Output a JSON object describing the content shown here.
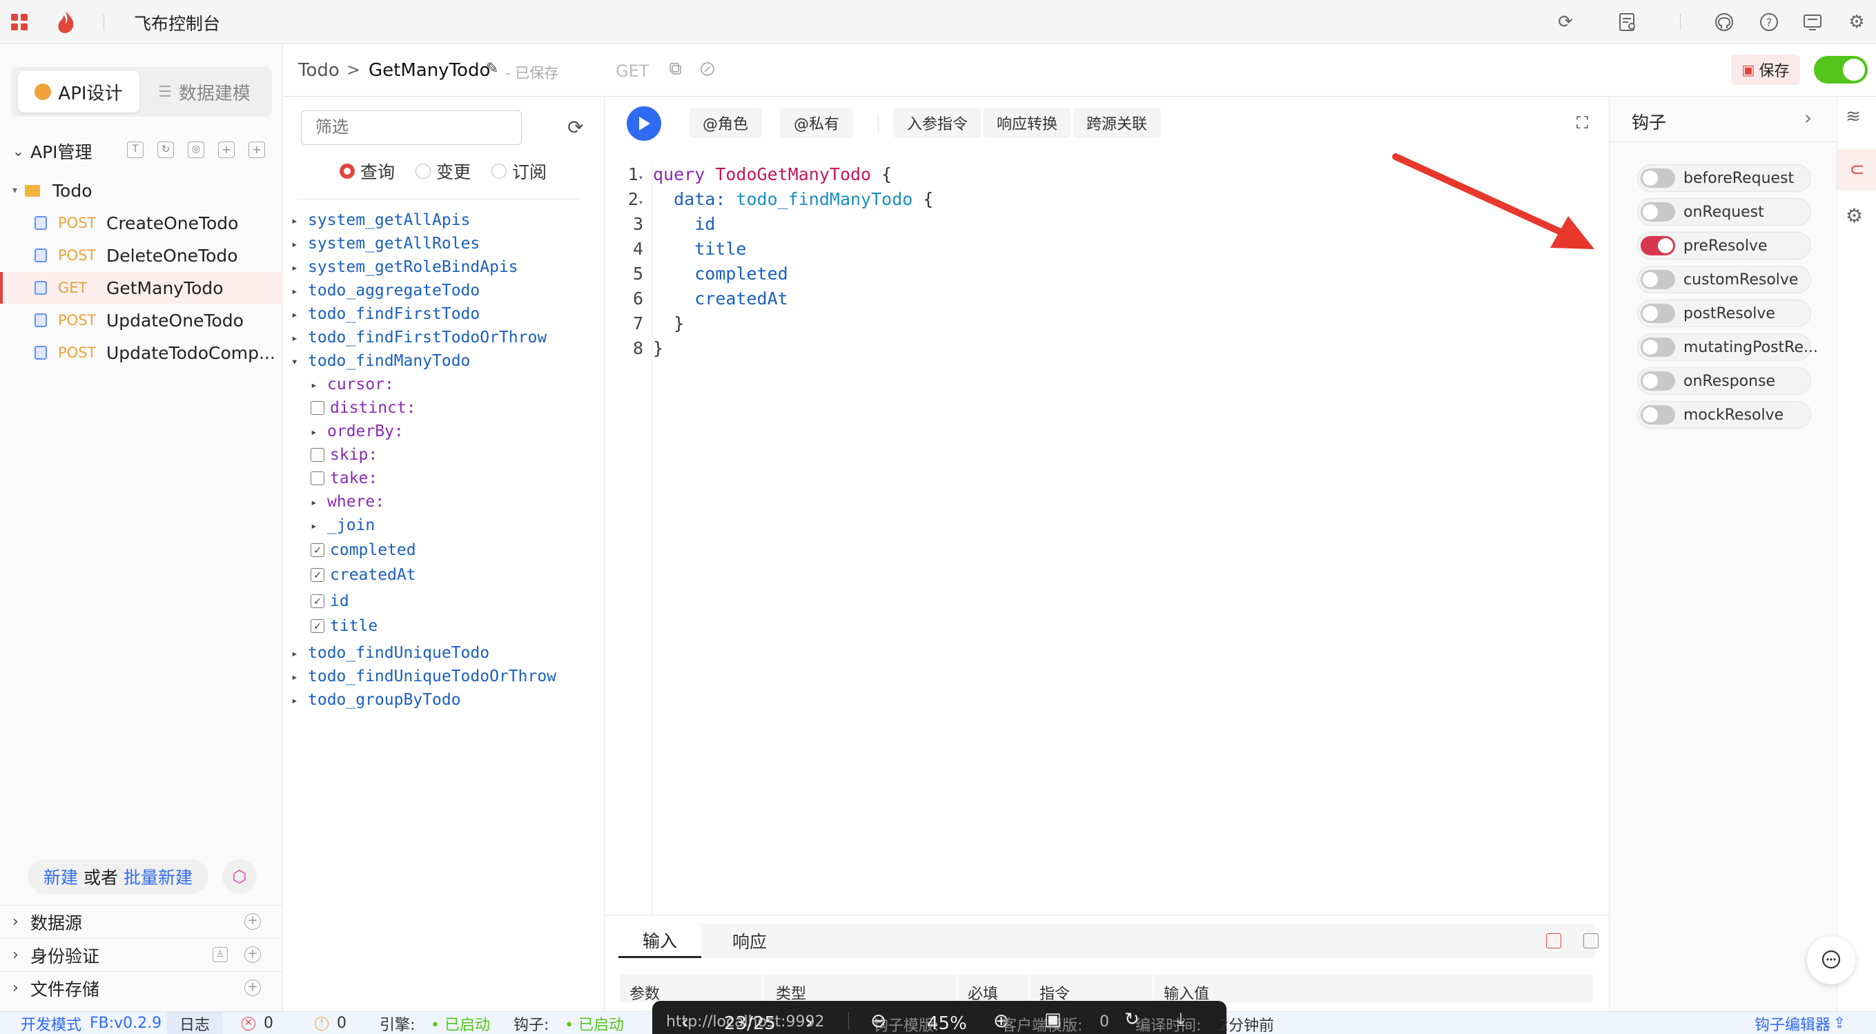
{
  "topbar": {
    "app_title": "飞布控制台"
  },
  "header": {
    "breadcrumb_root": "Todo",
    "breadcrumb_sep": ">",
    "breadcrumb_current": "GetManyTodo",
    "save_status": "- 已保存",
    "method": "GET",
    "save_label": "保存"
  },
  "sidebar": {
    "tab_api": "API设计",
    "tab_model": "数据建模",
    "section_title": "API管理",
    "folder": "Todo",
    "items": [
      {
        "method": "POST",
        "name": "CreateOneTodo"
      },
      {
        "method": "POST",
        "name": "DeleteOneTodo"
      },
      {
        "method": "GET",
        "name": "GetManyTodo"
      },
      {
        "method": "POST",
        "name": "UpdateOneTodo"
      },
      {
        "method": "POST",
        "name": "UpdateTodoComp..."
      }
    ],
    "new_label": "新建",
    "or_label": "或者",
    "batch_label": "批量新建",
    "sections": [
      "数据源",
      "身份验证",
      "文件存储"
    ]
  },
  "schema": {
    "filter_placeholder": "筛选",
    "op_query": "查询",
    "op_mutation": "变更",
    "op_subscription": "订阅",
    "top_items": [
      "system_getAllApis",
      "system_getAllRoles",
      "system_getRoleBindApis",
      "todo_aggregateTodo",
      "todo_findFirstTodo",
      "todo_findFirstTodoOrThrow"
    ],
    "expanded_item": "todo_findManyTodo",
    "args": [
      {
        "label": "cursor:",
        "kind": "arrow"
      },
      {
        "label": "distinct:",
        "kind": "box"
      },
      {
        "label": "orderBy:",
        "kind": "arrow"
      },
      {
        "label": "skip:",
        "kind": "box"
      },
      {
        "label": "take:",
        "kind": "box"
      },
      {
        "label": "where:",
        "kind": "arrow"
      },
      {
        "label": "_join",
        "kind": "arrow"
      }
    ],
    "fields": [
      "completed",
      "createdAt",
      "id",
      "title"
    ],
    "bottom_items": [
      "todo_findUniqueTodo",
      "todo_findUniqueTodoOrThrow",
      "todo_groupByTodo"
    ]
  },
  "toolbar": {
    "role": "@角色",
    "private": "@私有",
    "input_directive": "入参指令",
    "response_transform": "响应转换",
    "cross_source": "跨源关联"
  },
  "editor": {
    "lines": [
      {
        "n": "1",
        "fold": true
      },
      {
        "n": "2",
        "fold": true
      },
      {
        "n": "3"
      },
      {
        "n": "4"
      },
      {
        "n": "5"
      },
      {
        "n": "6"
      },
      {
        "n": "7"
      },
      {
        "n": "8"
      }
    ],
    "code": {
      "kw": "query",
      "op_name": "TodoGetManyTodo",
      "brace_open": "{",
      "data_key": "data:",
      "data_fn": "todo_findManyTodo",
      "f1": "id",
      "f2": "title",
      "f3": "completed",
      "f4": "createdAt",
      "close_inner": "}",
      "close_outer": "}"
    }
  },
  "hooks": {
    "title": "钩子",
    "items": [
      {
        "name": "beforeRequest",
        "on": false
      },
      {
        "name": "onRequest",
        "on": false
      },
      {
        "name": "preResolve",
        "on": true
      },
      {
        "name": "customResolve",
        "on": false
      },
      {
        "name": "postResolve",
        "on": false
      },
      {
        "name": "mutatingPostRe...",
        "on": false
      },
      {
        "name": "onResponse",
        "on": false
      },
      {
        "name": "mockResolve",
        "on": false
      }
    ]
  },
  "bottom": {
    "tab_input": "输入",
    "tab_response": "响应",
    "columns": [
      "参数",
      "类型",
      "必填",
      "指令",
      "输入值"
    ]
  },
  "statusbar": {
    "mode": "开发模式",
    "version": "FB:v0.2.9",
    "log": "日志",
    "errors": "0",
    "warnings": "0",
    "engine_label": "引擎:",
    "engine_status": "• 已启动",
    "hook_label": "钩子:",
    "hook_status": "• 已启动",
    "hook_editor": "钩子编辑器"
  },
  "viewer": {
    "url": "http://localhost:9992",
    "page": "23/25",
    "hook_template": "钩子模版:",
    "zoom": "45%",
    "client_template": "客户端模版:",
    "count": "0",
    "compile_time_label": "编译时间:",
    "compile_time": "2分钟前"
  },
  "colors": {
    "accent": "#2f6bf0",
    "post": "#f0a23a",
    "get": "#e0a23a",
    "hook_on": "#d9364f",
    "code_purple": "#8a2bb8",
    "code_blue": "#1a5fbf",
    "arrow_red": "#e8372c",
    "toggle_green": "#52c41a"
  }
}
